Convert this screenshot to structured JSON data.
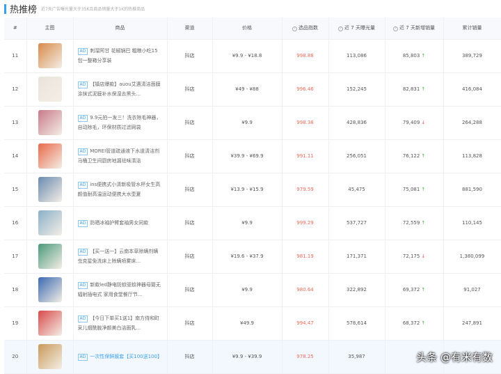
{
  "header": {
    "title": "热推榜",
    "subtitle": "近7天广告曝光量大于35K且商品销量大于1K的热推商品"
  },
  "columns": [
    "#",
    "主图",
    "商品",
    "渠道",
    "价格",
    "选品指数",
    "近 7 天曝光量",
    "近 7 天新增销量",
    "累计销量"
  ],
  "ad_label": "AD",
  "rows": [
    {
      "rank": "11",
      "name": "刺溜阿甘 花椒锅巴 粗粮小吃15包一整箱分享装",
      "channel": "抖店",
      "price": "¥9.9 - ¥18.8",
      "index": "998.88",
      "exposure": "113,086",
      "new_sales": "85,803",
      "trend": "↑",
      "total": "389,729",
      "color": "#d88a4a"
    },
    {
      "rank": "12",
      "name": "【镇店爆款】auou艾遇清洁面膜涂抹式泥膜补水保湿去黑头...",
      "channel": "抖店",
      "price": "¥49 - ¥88",
      "index": "996.46",
      "exposure": "152,245",
      "new_sales": "82,831",
      "trend": "↑",
      "total": "416,084",
      "color": "#e8e4dc"
    },
    {
      "rank": "13",
      "name": "9.9元拍一发三！洗衣除毛神器，自动除毛，环保材质过滤网袋",
      "channel": "抖店",
      "price": "¥9.9",
      "index": "998.38",
      "exposure": "428,836",
      "new_sales": "79,409",
      "trend": "↓",
      "total": "264,288",
      "color": "#c87a8a"
    },
    {
      "rank": "14",
      "name": "MOREI管道疏通液下水道清洁剂马桶卫生间厨房地漏祛味清洁",
      "channel": "抖店",
      "price": "¥39.9 - ¥69.9",
      "index": "991.11",
      "exposure": "256,051",
      "new_sales": "76,122",
      "trend": "↑",
      "total": "113,828",
      "color": "#e86a4a"
    },
    {
      "rank": "15",
      "name": "ins便携式小清新吸管水杯女生高颜值耐高温运动便携大水壶夏",
      "channel": "抖店",
      "price": "¥13.9 - ¥15.9",
      "index": "979.59",
      "exposure": "45,475",
      "new_sales": "75,081",
      "trend": "↑",
      "total": "881,590",
      "color": "#6a8ab0"
    },
    {
      "rank": "16",
      "name": "防晒冰袖护臂套袖男女同款",
      "channel": "抖店",
      "price": "¥9.9",
      "index": "999.29",
      "exposure": "537,727",
      "new_sales": "72,559",
      "trend": "↑",
      "total": "110,145",
      "color": "#8ab0c8"
    },
    {
      "rank": "17",
      "name": "【买一送一】云南本草除螨剂螨虫克星免洗床上除螨喷雾床...",
      "channel": "抖店",
      "price": "¥19.6 - ¥37.9",
      "index": "981.19",
      "exposure": "171,371",
      "new_sales": "72,175",
      "trend": "↓",
      "total": "1,380,099",
      "color": "#4a9a7a"
    },
    {
      "rank": "18",
      "name": "新款led静电防蚊驱蚊神器母婴无辐射插电式 家用食堂餐厅节...",
      "channel": "抖店",
      "price": "¥9.9",
      "index": "980.64",
      "exposure": "322,892",
      "new_sales": "69,372",
      "trend": "↑",
      "total": "91,027",
      "color": "#3a6ab0"
    },
    {
      "rank": "19",
      "name": "【今日下单买1送1】南方侍和町采儿烟酰胺净颜美白洁面乳...",
      "channel": "抖店",
      "price": "¥49.9",
      "index": "994.47",
      "exposure": "578,614",
      "new_sales": "68,372",
      "trend": "↑",
      "total": "247,891",
      "color": "#d84a4a"
    },
    {
      "rank": "20",
      "name": "一次性保鲜膜套【买100送100】",
      "channel": "抖店",
      "price": "¥9.9 - ¥39.9",
      "index": "978.25",
      "exposure": "35,987",
      "new_sales": "",
      "trend": "",
      "total": "",
      "color": "#c89a5a"
    }
  ],
  "watermark": "头条 @有米有数"
}
